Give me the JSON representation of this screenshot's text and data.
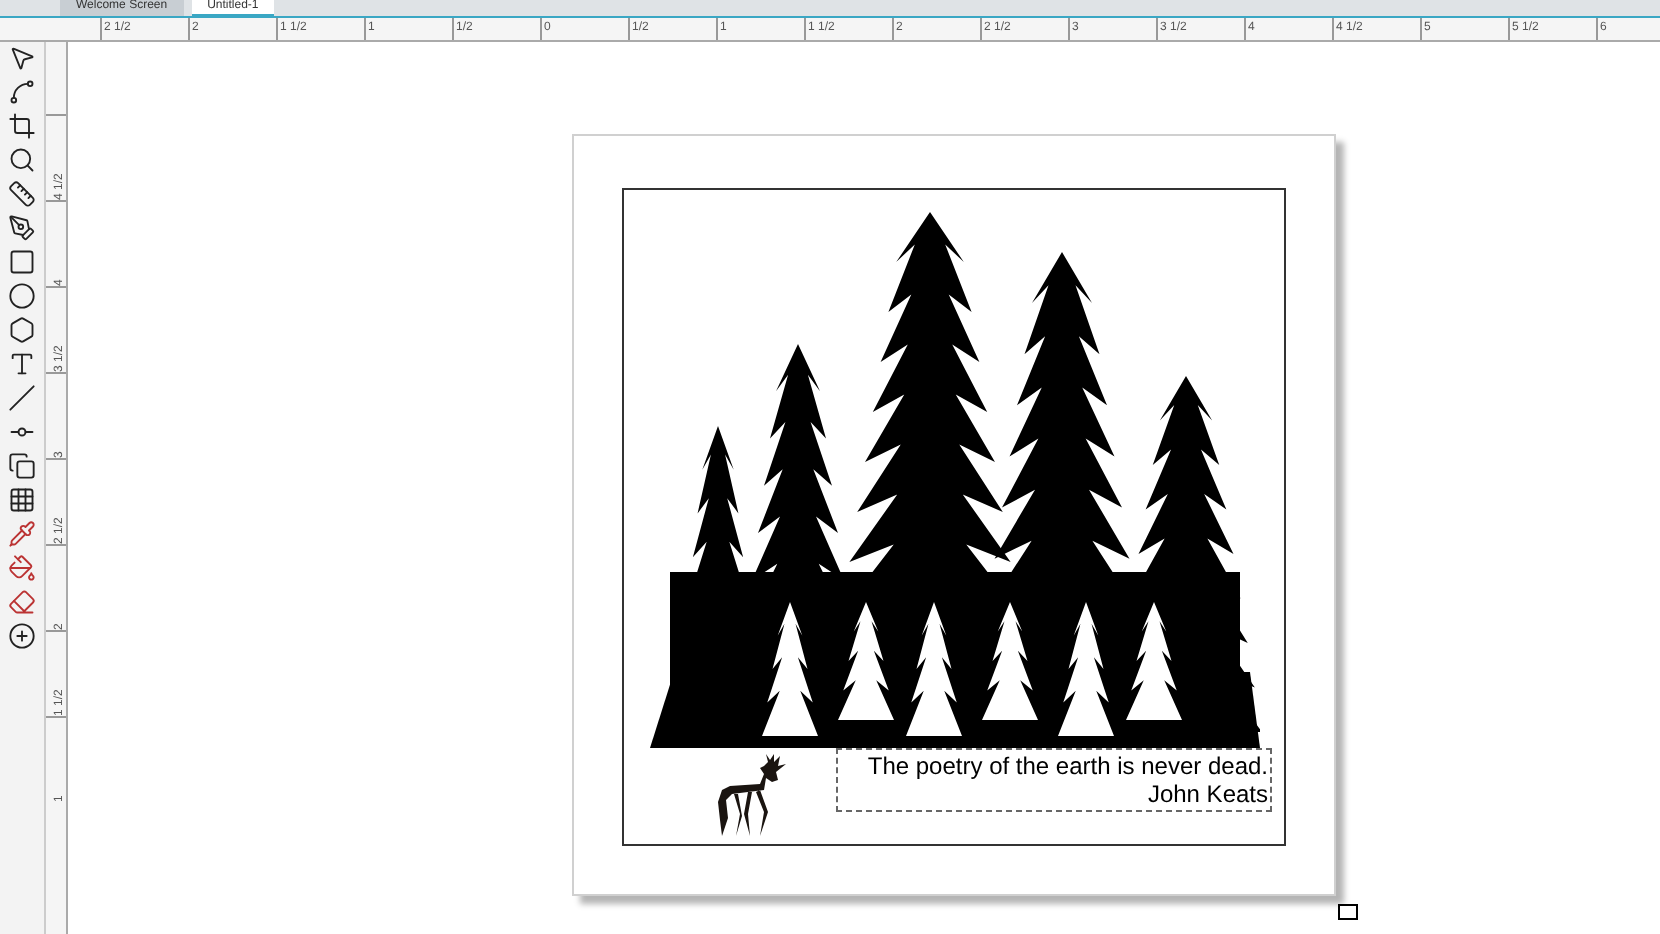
{
  "tabs": [
    {
      "label": "Welcome Screen",
      "selected": false
    },
    {
      "label": "Untitled-1",
      "selected": true
    }
  ],
  "horizontal_ruler": [
    "2 1/2",
    "2",
    "1 1/2",
    "1",
    "1/2",
    "0",
    "1/2",
    "1",
    "1 1/2",
    "2",
    "2 1/2",
    "3",
    "3 1/2",
    "4",
    "4 1/2",
    "5",
    "5 1/2",
    "6"
  ],
  "vertical_ruler": [
    "4 1/2",
    "4",
    "3 1/2",
    "3",
    "2 1/2",
    "2",
    "1 1/2",
    "1"
  ],
  "quote": {
    "text": "The poetry of the earth is never dead.",
    "author": "John Keats"
  }
}
